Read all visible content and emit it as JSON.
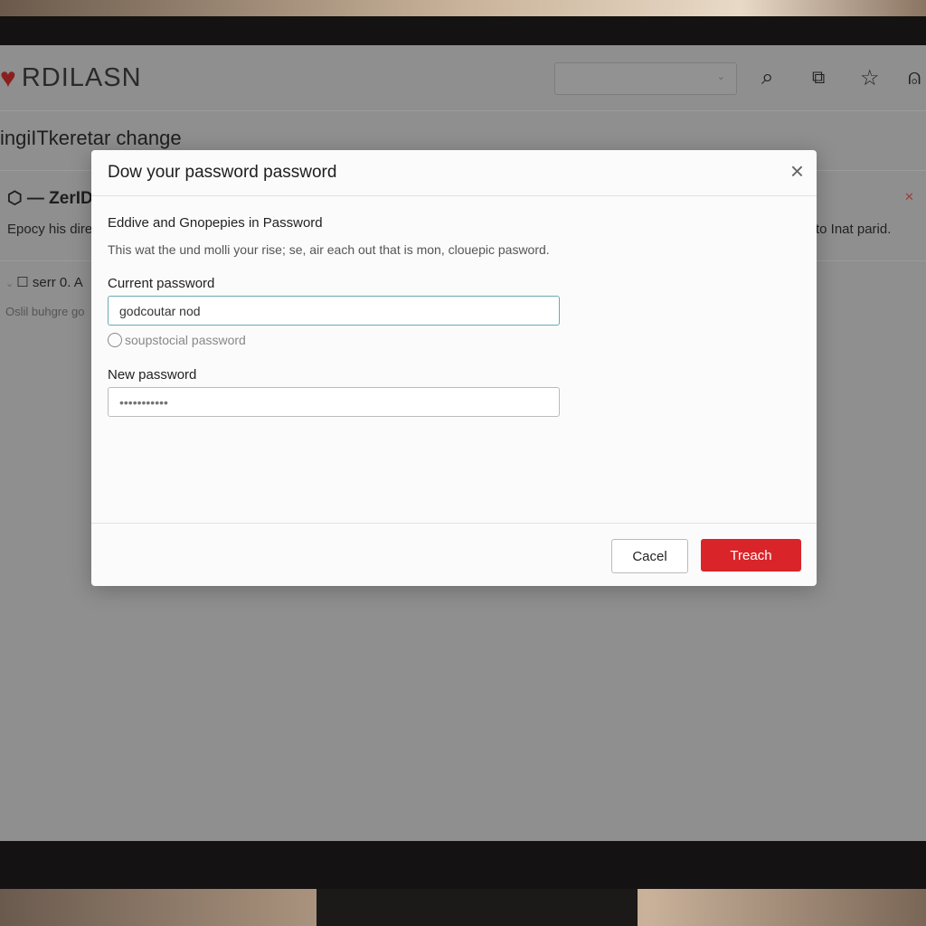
{
  "app": {
    "logo_text": "RDILASN",
    "logo_icon": "heart-icon"
  },
  "toolbar": {
    "select_value": "",
    "icons": [
      "search-icon",
      "share-icon",
      "star-icon",
      "user-icon"
    ]
  },
  "page": {
    "title": "ingiITkeretar change",
    "section_title": "ZerID",
    "section_desc_left": "Epocy his dire",
    "section_desc_right": "to Inat parid.",
    "row_label": "serr 0. A",
    "row_desc": "Oslil buhgre go"
  },
  "dialog": {
    "title": "Dow your password password",
    "subtitle": "Eddive and Gnopepies in Password",
    "description": "This wat the und molli your rise; se, air each out that is mon, clouepic pasword.",
    "current_label": "Current password",
    "current_value": "godcoutar nod",
    "radio_label": "soupstocial password",
    "new_label": "New password",
    "new_placeholder": "•••••••••••",
    "cancel_label": "Cacel",
    "submit_label": "Treach",
    "accent_color": "#d9252a"
  }
}
